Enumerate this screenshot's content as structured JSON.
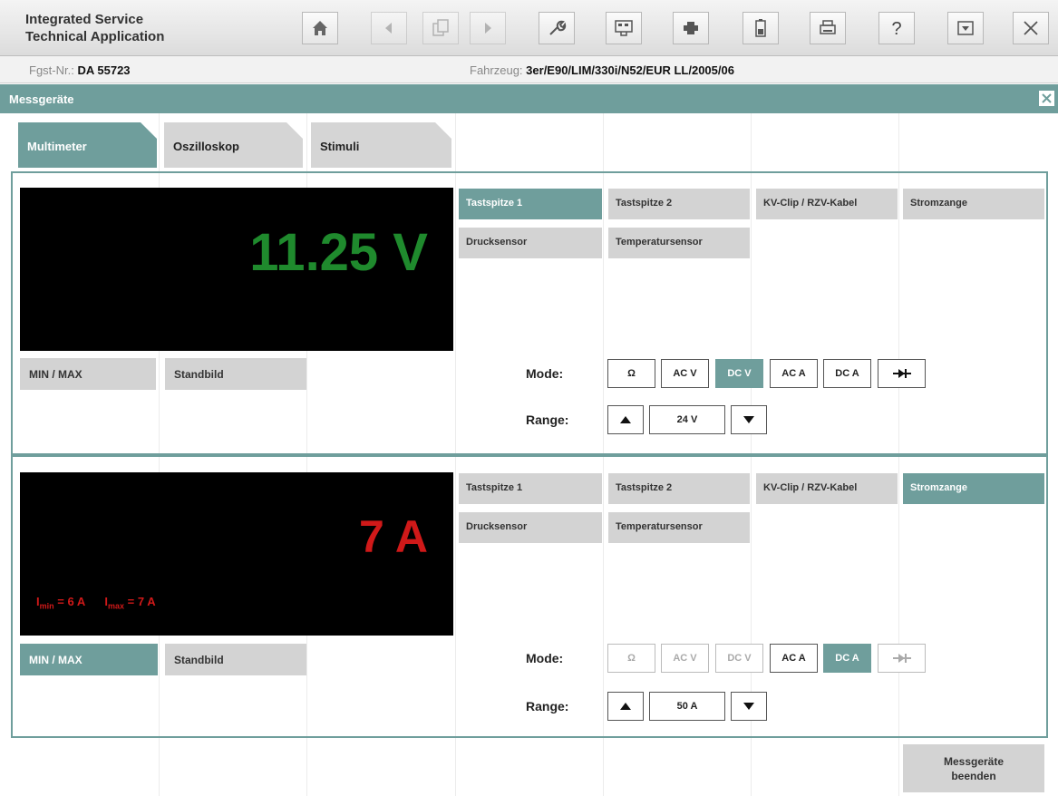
{
  "app": {
    "title_line1": "Integrated Service",
    "title_line2": "Technical Application"
  },
  "toolbar": {
    "icons": [
      "home-icon",
      "back-icon",
      "copy-icon",
      "forward-icon",
      "wrench-icon",
      "diagnosis-icon",
      "connector-icon",
      "battery-icon",
      "print-icon",
      "help-icon",
      "minimize-icon",
      "close-icon"
    ]
  },
  "vehicle": {
    "fgst_label": "Fgst-Nr.:",
    "fgst_value": "DA 55723",
    "fzg_label": "Fahrzeug:",
    "fzg_value": "3er/E90/LIM/330i/N52/EUR LL/2005/06"
  },
  "section": {
    "title": "Messgeräte"
  },
  "tabs": [
    {
      "label": "Multimeter",
      "active": true
    },
    {
      "label": "Oszilloskop",
      "active": false
    },
    {
      "label": "Stimuli",
      "active": false
    }
  ],
  "meter1": {
    "reading": "11.25 V",
    "reading_color": "#1f8a2d",
    "minmax_label": "MIN / MAX",
    "standbild_label": "Standbild",
    "probes": [
      "Tastspitze 1",
      "Tastspitze 2",
      "KV-Clip / RZV-Kabel",
      "Stromzange",
      "Drucksensor",
      "Temperatursensor"
    ],
    "active_probe": "Tastspitze 1",
    "mode_label": "Mode:",
    "modes": [
      "Ω",
      "AC V",
      "DC V",
      "AC A",
      "DC A",
      "diode"
    ],
    "selected_mode": "DC V",
    "range_label": "Range:",
    "range_value": "24 V"
  },
  "meter2": {
    "reading": "7 A",
    "reading_color": "#d01919",
    "min_text_i": "I",
    "min_sub": "min",
    "min_value": " = 6 A",
    "max_text_i": "I",
    "max_sub": "max",
    "max_value": " = 7 A",
    "minmax_label": "MIN / MAX",
    "standbild_label": "Standbild",
    "probes": [
      "Tastspitze 1",
      "Tastspitze 2",
      "KV-Clip / RZV-Kabel",
      "Stromzange",
      "Drucksensor",
      "Temperatursensor"
    ],
    "active_probe": "Stromzange",
    "mode_label": "Mode:",
    "modes": [
      "Ω",
      "AC V",
      "DC V",
      "AC A",
      "DC A",
      "diode"
    ],
    "selected_mode": "DC A",
    "range_label": "Range:",
    "range_value": "50 A"
  },
  "footer": {
    "end_line1": "Messgeräte",
    "end_line2": "beenden"
  },
  "colors": {
    "accent": "#6f9e9c",
    "button_gray": "#d3d3d3"
  }
}
